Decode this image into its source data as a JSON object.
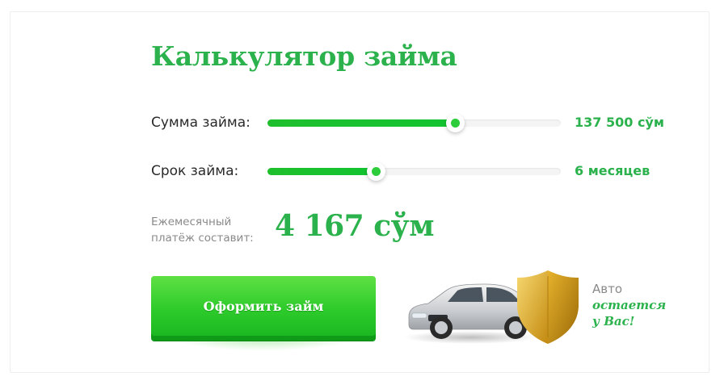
{
  "calculator": {
    "title": "Калькулятор займа",
    "amount": {
      "label": "Сумма займа:",
      "value_text": "137 500 сўм",
      "slider_fraction": 0.64
    },
    "term": {
      "label": "Срок займа:",
      "value_text": "6 месяцев",
      "slider_fraction": 0.37
    },
    "payment": {
      "label_line1": "Ежемесячный",
      "label_line2": "платёж составит:",
      "amount": "4 167 сўм"
    },
    "submit_label": "Оформить займ"
  },
  "promo": {
    "line1": "Авто",
    "line2": "остается",
    "line3": "у Вас!",
    "image": "car-with-shield-illustration"
  },
  "colors": {
    "accent": "#2bb24c",
    "slider": "#1fc22c",
    "button_top": "#5fe043",
    "button_bottom": "#19b520"
  }
}
